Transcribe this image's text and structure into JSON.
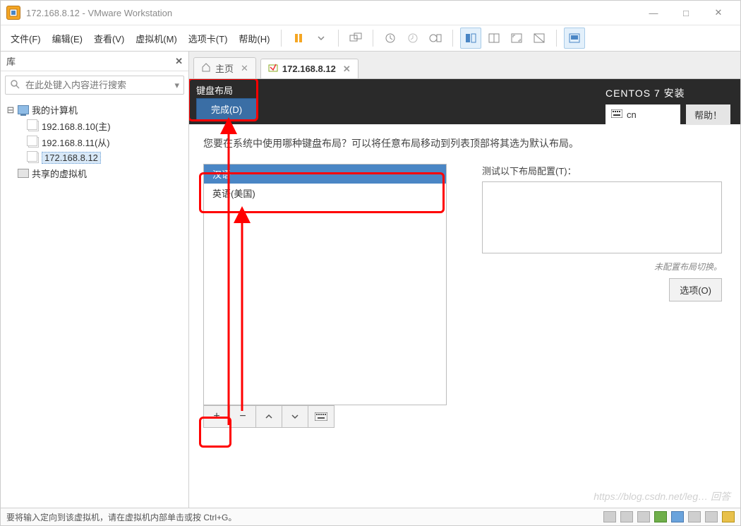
{
  "window": {
    "title": "172.168.8.12 - VMware Workstation",
    "controls": {
      "min": "—",
      "max": "□",
      "close": "✕"
    }
  },
  "menu": {
    "file": "文件(F)",
    "edit": "编辑(E)",
    "view": "查看(V)",
    "vm": "虚拟机(M)",
    "tabs": "选项卡(T)",
    "help": "帮助(H)"
  },
  "sidebar": {
    "title": "库",
    "search_placeholder": "在此处键入内容进行搜索",
    "root": "我的计算机",
    "items": [
      "192.168.8.10(主)",
      "192.168.8.11(从)",
      "172.168.8.12"
    ],
    "shared": "共享的虚拟机"
  },
  "tabs": {
    "home": "主页",
    "vm": "172.168.8.12"
  },
  "installer": {
    "header_title": "键盘布局",
    "done": "完成(D)",
    "install_title": "CENTOS 7 安装",
    "lang_code": "cn",
    "help": "帮助！",
    "prompt": "您要在系统中使用哪种键盘布局？可以将任意布局移动到列表顶部将其选为默认布局。",
    "layouts": [
      "汉语",
      "英语(美国)"
    ],
    "test_label": "测试以下布局配置(T)：",
    "no_config": "未配置布局切换。",
    "options": "选项(O)"
  },
  "toolbar_buttons": {
    "plus": "+",
    "minus": "−",
    "up": "⌃",
    "down": "⌄",
    "kb": "⌨"
  },
  "status": {
    "text": "要将输入定向到该虚拟机，请在虚拟机内部单击或按 Ctrl+G。"
  },
  "watermark": "https://blog.csdn.net/leg… 回答"
}
